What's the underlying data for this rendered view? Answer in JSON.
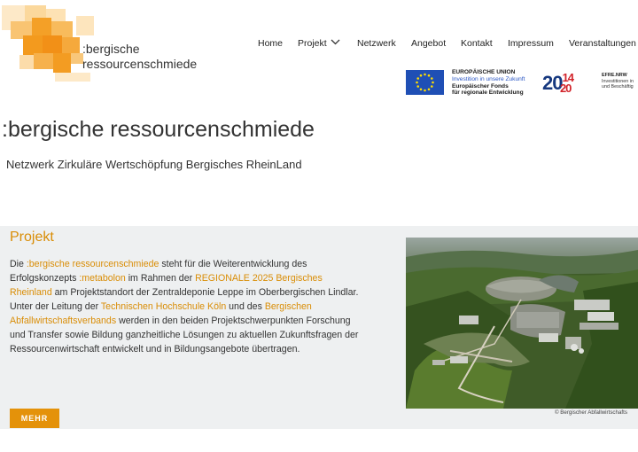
{
  "header": {
    "logo": {
      "line1": ":bergische",
      "line2": "ressourcenschmiede"
    },
    "nav": [
      {
        "label": "Home"
      },
      {
        "label": "Projekt",
        "has_dropdown": true
      },
      {
        "label": "Netzwerk"
      },
      {
        "label": "Angebot"
      },
      {
        "label": "Kontakt"
      },
      {
        "label": "Impressum"
      },
      {
        "label": "Veranstaltungen"
      }
    ],
    "eu_logo": {
      "line1": "EUROPÄISCHE UNION",
      "line2": "Investition in unsere Zukunft",
      "line3": "Europäischer Fonds",
      "line4": "für regionale Entwicklung"
    },
    "efre_logo": {
      "year_blue": "20",
      "year_red": "14",
      "year_red2": "20",
      "name": "EFRE.NRW",
      "line2": "Investitionen in",
      "line3": "und Beschäftig"
    }
  },
  "page": {
    "title": ":bergische ressourcenschmiede",
    "subtitle": "Netzwerk Zirkuläre Wertschöpfung Bergisches RheinLand"
  },
  "project": {
    "heading": "Projekt",
    "p1_a": "Die ",
    "p1_link1": ":bergische ressourcenschmiede",
    "p1_b": " steht für die Weiterentwicklung des Erfolgskonzepts ",
    "p1_link2": ":metabolon",
    "p1_c": " im Rahmen der ",
    "p1_link3": "REGIONALE 2025 Bergisches Rheinland",
    "p1_d": " am Projektstandort der Zentraldeponie Leppe im Oberbergischen Lindlar.",
    "p2_a": "Unter der Leitung der ",
    "p2_link1": "Technischen Hochschule Köln",
    "p2_b": " und des ",
    "p2_link2": "Bergischen Abfallwirtschaftsverbands",
    "p2_c": " werden in den beiden Projektschwerpunkten Forschung und Transfer sowie Bildung ganzheitliche Lösungen zu aktuellen Zukunftsfragen der Ressourcenwirtschaft entwickelt und in Bildungsangebote übertragen.",
    "more_label": "MEHR",
    "photo_credit": "© Bergischer Abfallwirtschafts"
  },
  "colors": {
    "accent": "#e4920a",
    "link": "#d98d06",
    "section_bg": "#eef0f1",
    "eu_blue": "#1f4fb5"
  }
}
